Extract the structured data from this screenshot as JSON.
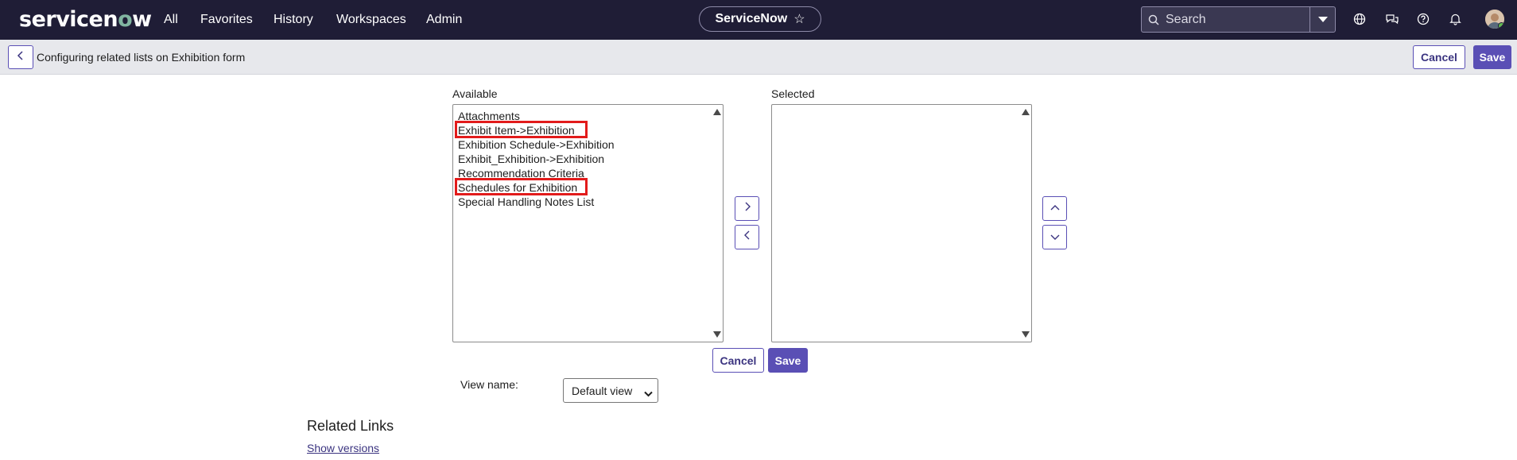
{
  "topbar": {
    "logo": {
      "prefix": "servicen",
      "o": "o",
      "suffix": "w"
    },
    "nav": [
      "All",
      "Favorites",
      "History",
      "Workspaces",
      "Admin"
    ],
    "app_pill": "ServiceNow",
    "search_placeholder": "Search",
    "icons": [
      "globe-icon",
      "chat-icon",
      "help-icon",
      "bell-icon",
      "avatar"
    ]
  },
  "subbar": {
    "title": "Configuring related lists on Exhibition form",
    "cancel": "Cancel",
    "save": "Save"
  },
  "slushbucket": {
    "available_label": "Available",
    "selected_label": "Selected",
    "available": [
      "Attachments",
      "Exhibit Item->Exhibition",
      "Exhibition Schedule->Exhibition",
      "Exhibit_Exhibition->Exhibition",
      "Recommendation Criteria",
      "Schedules for Exhibition",
      "Special Handling Notes List"
    ],
    "selected": [],
    "highlighted": [
      "Exhibit Item->Exhibition",
      "Schedules for Exhibition"
    ]
  },
  "form": {
    "cancel": "Cancel",
    "save": "Save",
    "view_name_label": "View name:",
    "view_name_value": "Default view"
  },
  "related": {
    "heading": "Related Links",
    "show_versions": "Show versions"
  },
  "colors": {
    "nav_bg": "#1f1d36",
    "accent": "#5a4fb5",
    "highlight": "#e21b1b"
  }
}
